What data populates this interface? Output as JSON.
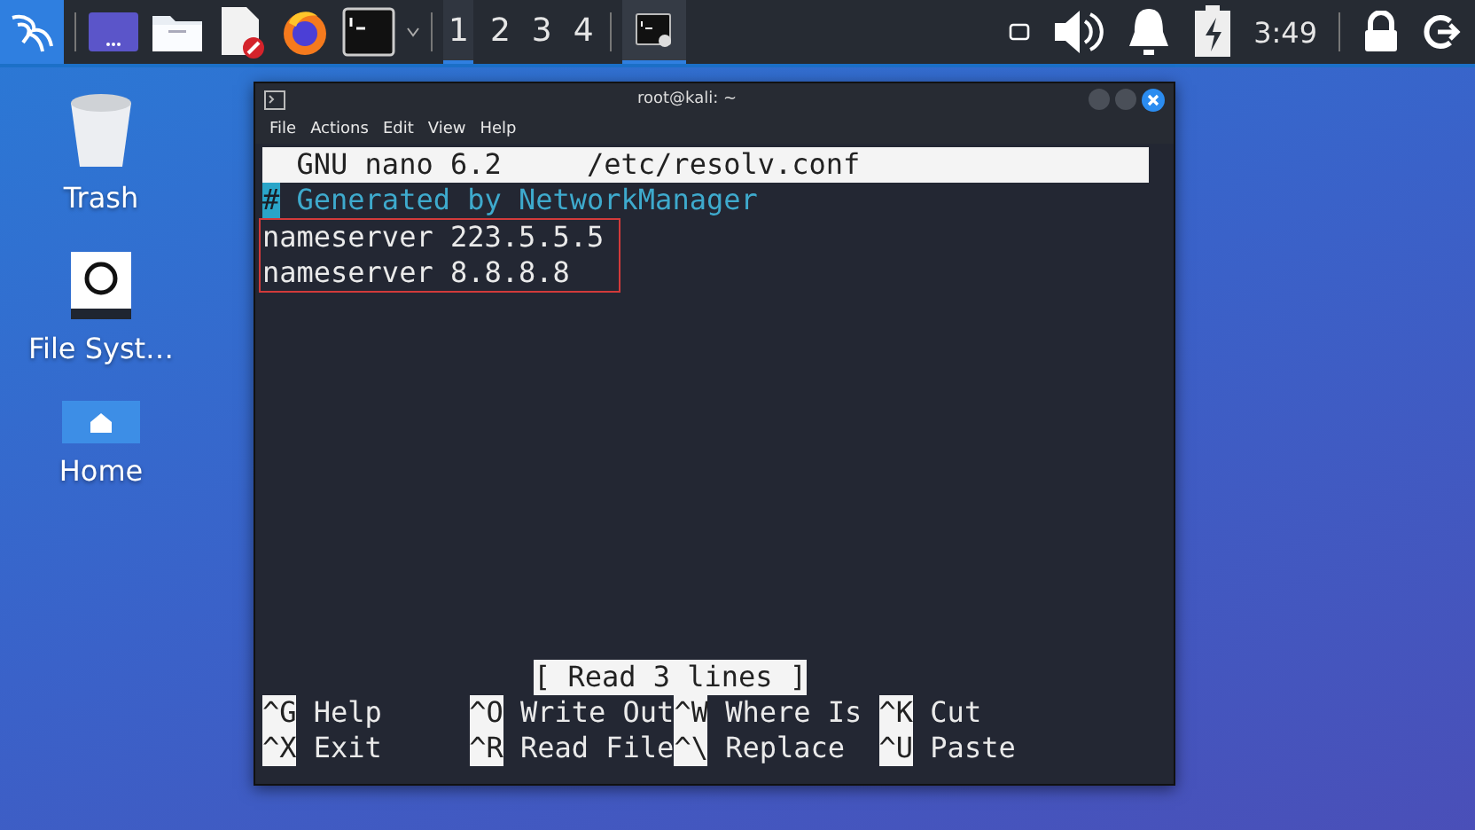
{
  "taskbar": {
    "workspaces": [
      {
        "label": "1",
        "selected": true
      },
      {
        "label": "2",
        "selected": false
      },
      {
        "label": "3",
        "selected": false
      },
      {
        "label": "4",
        "selected": false
      }
    ],
    "clock": "3:49"
  },
  "desktop_icons": [
    {
      "label": "Trash",
      "kind": "trash"
    },
    {
      "label": "File Syst…",
      "kind": "drive"
    },
    {
      "label": "Home",
      "kind": "home"
    }
  ],
  "window": {
    "title": "root@kali: ~",
    "menu": [
      "File",
      "Actions",
      "Edit",
      "View",
      "Help"
    ],
    "nano": {
      "version_label": "GNU nano 6.2",
      "file_name": "/etc/resolv.conf",
      "comment_line": {
        "cursor": "#",
        "text": "Generated by NetworkManager"
      },
      "boxed_lines": [
        "nameserver 223.5.5.5",
        "nameserver 8.8.8.8"
      ],
      "status": "[ Read 3 lines ]",
      "shortcuts": [
        [
          {
            "key": "^G",
            "label": "Help"
          },
          {
            "key": "^O",
            "label": "Write Out"
          },
          {
            "key": "^W",
            "label": "Where Is"
          },
          {
            "key": "^K",
            "label": "Cut"
          }
        ],
        [
          {
            "key": "^X",
            "label": "Exit"
          },
          {
            "key": "^R",
            "label": "Read File"
          },
          {
            "key": "^\\",
            "label": "Replace"
          },
          {
            "key": "^U",
            "label": "Paste"
          }
        ]
      ]
    }
  }
}
